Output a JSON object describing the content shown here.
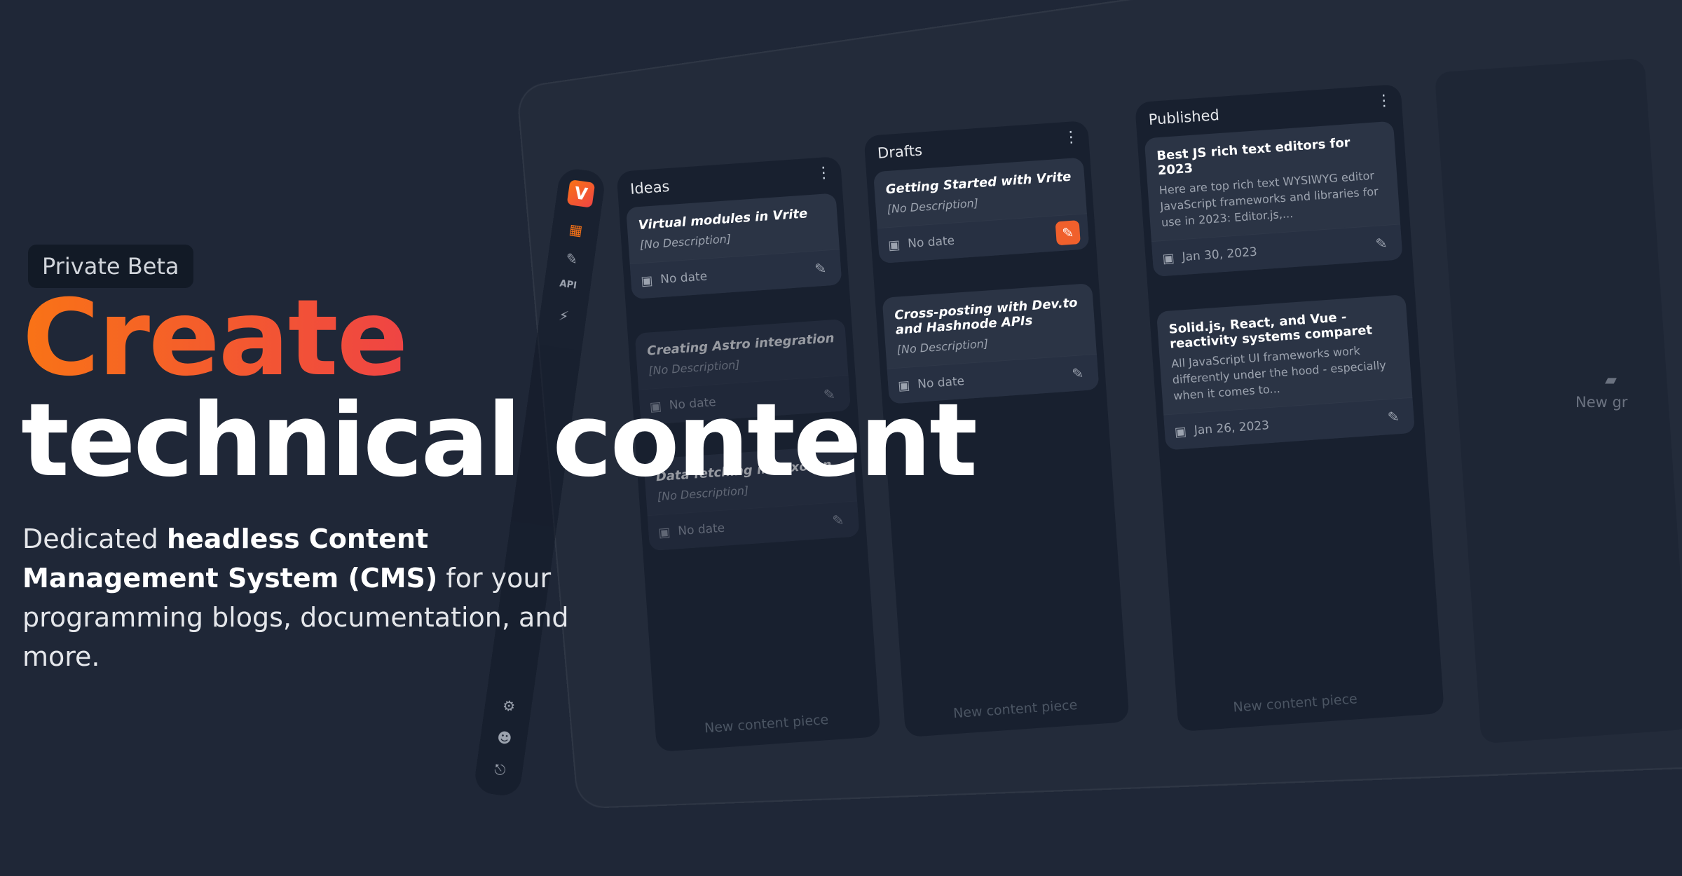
{
  "badge": "Private Beta",
  "headline": {
    "line1": "Create",
    "line2": "technical content"
  },
  "subtitle": {
    "pre": "Dedicated ",
    "bold": "headless Content Management System (CMS)",
    "post": " for your programming blogs, documentation, and more."
  },
  "sidebar": {
    "logo": "V",
    "items": [
      {
        "icon": "dashboard-icon",
        "glyph": "▦"
      },
      {
        "icon": "pencil-icon",
        "glyph": "✎"
      },
      {
        "icon": "api-icon",
        "glyph": "API"
      },
      {
        "icon": "plug-icon",
        "glyph": "⚡"
      }
    ],
    "bottom": [
      {
        "icon": "gear-icon",
        "glyph": "⚙"
      },
      {
        "icon": "discord-icon",
        "glyph": "☻"
      },
      {
        "icon": "logout-icon",
        "glyph": "⎋"
      }
    ]
  },
  "columns": [
    {
      "name": "Ideas",
      "cards": [
        {
          "title": "Virtual modules in Vrite",
          "desc": "[No Description]",
          "date": "No date"
        },
        {
          "title": "Creating Astro integration",
          "desc": "[No Description]",
          "date": "No date"
        },
        {
          "title": "Data fetching in Lexoran",
          "desc": "[No Description]",
          "date": "No date"
        }
      ],
      "new_label": "New content piece"
    },
    {
      "name": "Drafts",
      "cards": [
        {
          "title": "Getting Started with Vrite",
          "desc": "[No Description]",
          "date": "No date"
        },
        {
          "title": "Cross-posting with Dev.to and Hashnode APIs",
          "desc": "[No Description]",
          "date": "No date"
        }
      ],
      "new_label": "New content piece"
    },
    {
      "name": "Published",
      "cards": [
        {
          "title": "Best JS rich text editors for 2023",
          "desc": "Here are top rich text WYSIWYG editor JavaScript frameworks and libraries for use in 2023: Editor.js,...",
          "date": "Jan 30, 2023"
        },
        {
          "title": "Solid.js, React, and Vue - reactivity systems comparet",
          "desc": "All JavaScript UI frameworks work differently under the hood - especially when it comes to...",
          "date": "Jan 26, 2023"
        }
      ],
      "new_label": "New content piece"
    }
  ],
  "new_group_label": "New gr",
  "colors": {
    "accent": "#f97316",
    "accent_end": "#ef4444",
    "background": "#1f2737"
  }
}
